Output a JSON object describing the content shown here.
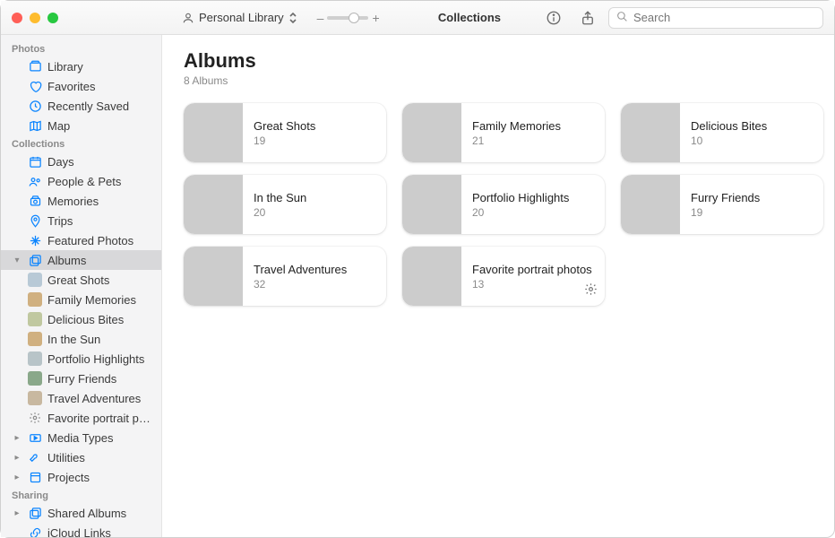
{
  "toolbar": {
    "library_label": "Personal Library",
    "zoom_minus": "–",
    "zoom_plus": "+",
    "zoom_position_pct": 65,
    "view_label": "Collections",
    "search_placeholder": "Search"
  },
  "sidebar": {
    "sections": [
      {
        "title": "Photos",
        "items": [
          {
            "label": "Library",
            "icon": "library-icon"
          },
          {
            "label": "Favorites",
            "icon": "heart-icon"
          },
          {
            "label": "Recently Saved",
            "icon": "clock-icon"
          },
          {
            "label": "Map",
            "icon": "map-icon"
          }
        ]
      },
      {
        "title": "Collections",
        "items": [
          {
            "label": "Days",
            "icon": "calendar-icon"
          },
          {
            "label": "People & Pets",
            "icon": "people-icon"
          },
          {
            "label": "Memories",
            "icon": "memories-icon"
          },
          {
            "label": "Trips",
            "icon": "pin-icon"
          },
          {
            "label": "Featured Photos",
            "icon": "sparkle-icon"
          },
          {
            "label": "Albums",
            "icon": "albums-icon",
            "selected": true,
            "disclosure": "open",
            "children": [
              {
                "label": "Great Shots"
              },
              {
                "label": "Family Memories"
              },
              {
                "label": "Delicious Bites"
              },
              {
                "label": "In the Sun"
              },
              {
                "label": "Portfolio Highlights"
              },
              {
                "label": "Furry Friends"
              },
              {
                "label": "Travel Adventures"
              },
              {
                "label": "Favorite portrait photos",
                "icon": "gear-icon"
              }
            ]
          },
          {
            "label": "Media Types",
            "icon": "mediatypes-icon",
            "disclosure": "closed"
          },
          {
            "label": "Utilities",
            "icon": "utilities-icon",
            "disclosure": "closed"
          },
          {
            "label": "Projects",
            "icon": "projects-icon",
            "disclosure": "closed"
          }
        ]
      },
      {
        "title": "Sharing",
        "items": [
          {
            "label": "Shared Albums",
            "icon": "shared-icon",
            "disclosure": "closed"
          },
          {
            "label": "iCloud Links",
            "icon": "link-icon"
          }
        ]
      }
    ]
  },
  "content": {
    "heading": "Albums",
    "subheading": "8 Albums",
    "albums": [
      {
        "title": "Great Shots",
        "count": "19"
      },
      {
        "title": "Family Memories",
        "count": "21"
      },
      {
        "title": "Delicious Bites",
        "count": "10"
      },
      {
        "title": "In the Sun",
        "count": "20"
      },
      {
        "title": "Portfolio Highlights",
        "count": "20"
      },
      {
        "title": "Furry Friends",
        "count": "19"
      },
      {
        "title": "Travel Adventures",
        "count": "32"
      },
      {
        "title": "Favorite portrait photos",
        "count": "13",
        "smart": true
      }
    ]
  }
}
